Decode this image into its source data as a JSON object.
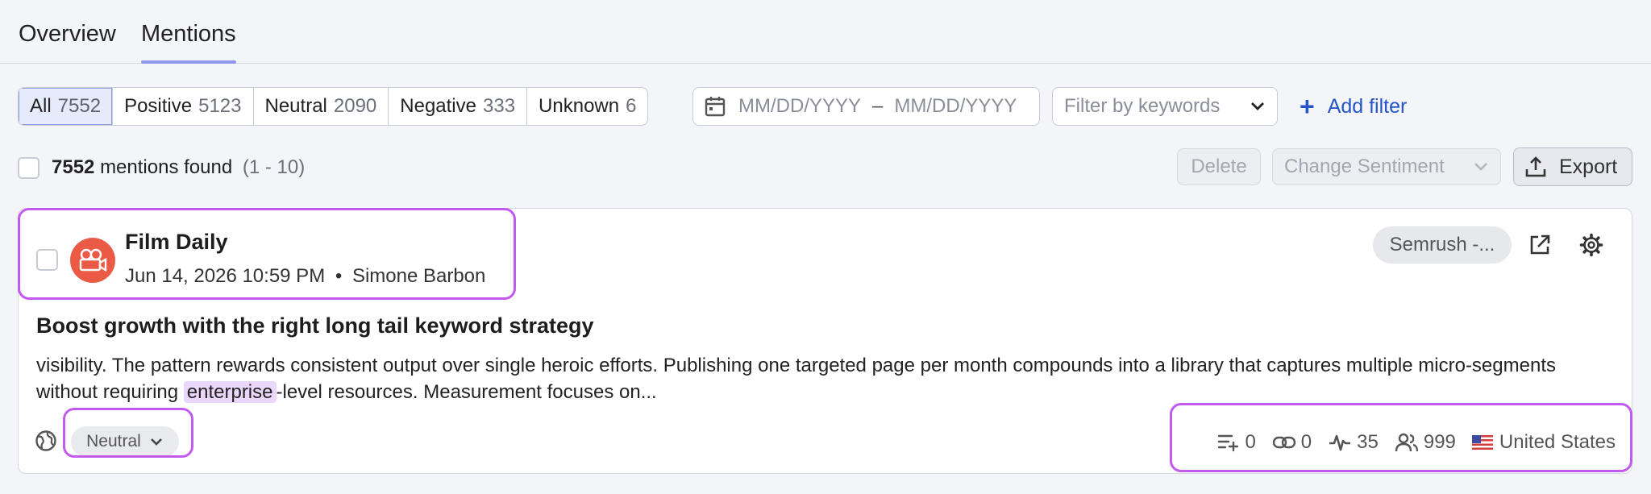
{
  "tabs": [
    {
      "label": "Overview"
    },
    {
      "label": "Mentions"
    }
  ],
  "sentiment_filters": [
    {
      "label": "All",
      "count": "7552"
    },
    {
      "label": "Positive",
      "count": "5123"
    },
    {
      "label": "Neutral",
      "count": "2090"
    },
    {
      "label": "Negative",
      "count": "333"
    },
    {
      "label": "Unknown",
      "count": "6"
    }
  ],
  "date_range": {
    "start_placeholder": "MM/DD/YYYY",
    "separator": "–",
    "end_placeholder": "MM/DD/YYYY"
  },
  "keywords_filter": {
    "placeholder": "Filter by keywords"
  },
  "add_filter": {
    "plus": "+",
    "label": "Add filter"
  },
  "results": {
    "count": "7552",
    "label": "mentions found",
    "range": "(1 - 10)"
  },
  "actions": {
    "delete": "Delete",
    "change_sentiment": "Change Sentiment",
    "export": "Export"
  },
  "mention": {
    "source": "Film Daily",
    "date": "Jun 14, 2026 10:59 PM",
    "dot": "•",
    "author": "Simone Barbon",
    "project_tag": "Semrush -...",
    "headline": "Boost growth with the right long tail keyword strategy",
    "snippet_before": "visibility. The pattern rewards consistent output over single heroic efforts. Publishing one targeted page per month compounds into a library that captures multiple micro-segments without requiring ",
    "snippet_highlight": "enterprise",
    "snippet_after": "-level resources. Measurement focuses on...",
    "sentiment": "Neutral",
    "stats": {
      "mentions": "0",
      "backlinks": "0",
      "activity": "35",
      "reach": "999",
      "country": "United States"
    }
  },
  "colors": {
    "accent": "#2454c8",
    "highlight_outline": "#c25af0",
    "keyword_highlight": "#ead7fb",
    "avatar_bg": "#ea5a45",
    "active_tab_underline": "#8e98ea"
  }
}
